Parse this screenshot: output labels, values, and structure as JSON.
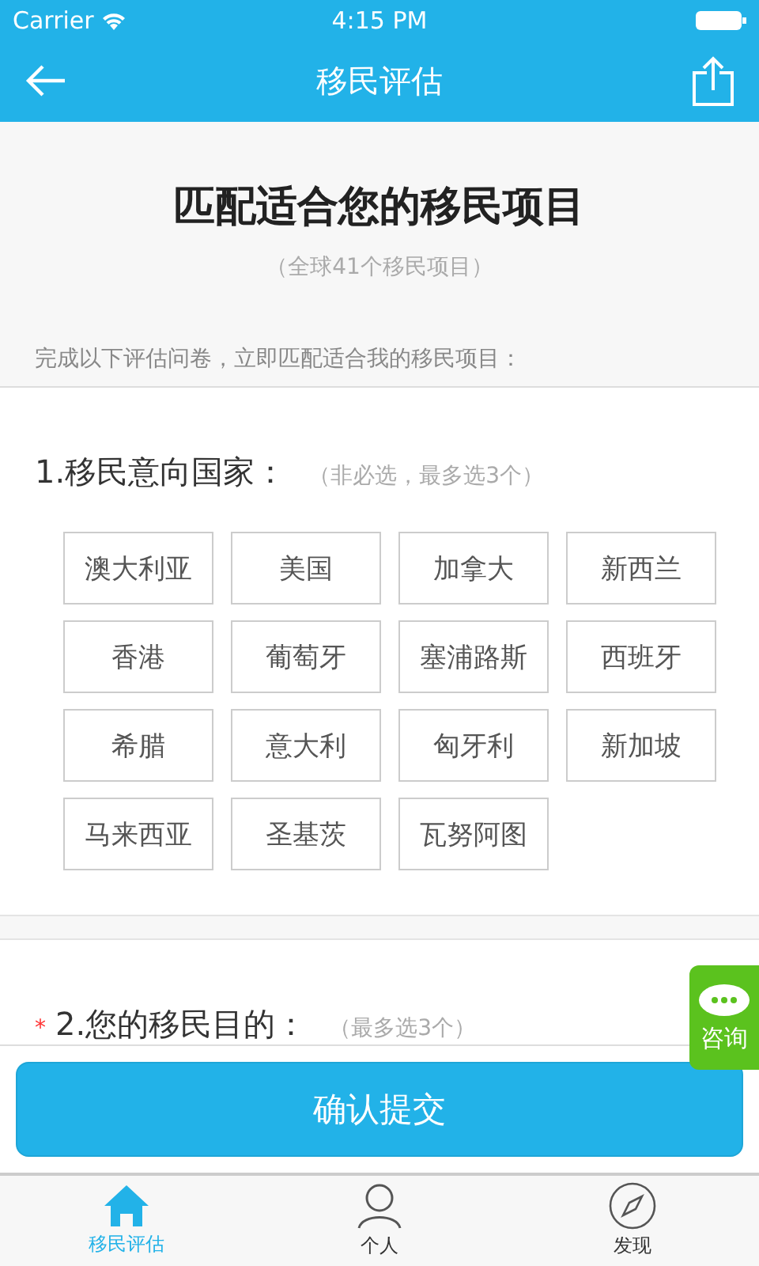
{
  "status_bar": {
    "carrier": "Carrier",
    "time": "4:15 PM"
  },
  "nav": {
    "title": "移民评估"
  },
  "header": {
    "title": "匹配适合您的移民项目",
    "subtitle": "（全球41个移民项目）",
    "intro": "完成以下评估问卷，立即匹配适合我的移民项目："
  },
  "questions": [
    {
      "number_title": "1.移民意向国家：",
      "hint": "（非必选，最多选3个）",
      "options": [
        {
          "label": "澳大利亚",
          "selected": false
        },
        {
          "label": "美国",
          "selected": false
        },
        {
          "label": "加拿大",
          "selected": false
        },
        {
          "label": "新西兰",
          "selected": false
        },
        {
          "label": "香港",
          "selected": false
        },
        {
          "label": "葡萄牙",
          "selected": false
        },
        {
          "label": "塞浦路斯",
          "selected": false
        },
        {
          "label": "西班牙",
          "selected": false
        },
        {
          "label": "希腊",
          "selected": false
        },
        {
          "label": "意大利",
          "selected": false
        },
        {
          "label": "匈牙利",
          "selected": false
        },
        {
          "label": "新加坡",
          "selected": false
        },
        {
          "label": "马来西亚",
          "selected": false
        },
        {
          "label": "圣基茨",
          "selected": false
        },
        {
          "label": "瓦努阿图",
          "selected": false
        }
      ]
    },
    {
      "required_mark": "*",
      "number_title": "2.您的移民目的：",
      "hint": "（最多选3个）"
    }
  ],
  "consult": {
    "label": "咨询"
  },
  "submit": {
    "label": "确认提交"
  },
  "tabs": [
    {
      "label": "移民评估",
      "kind": "home",
      "selected": true
    },
    {
      "label": "个人",
      "kind": "person",
      "selected": false
    },
    {
      "label": "发现",
      "kind": "compass",
      "selected": false
    }
  ]
}
